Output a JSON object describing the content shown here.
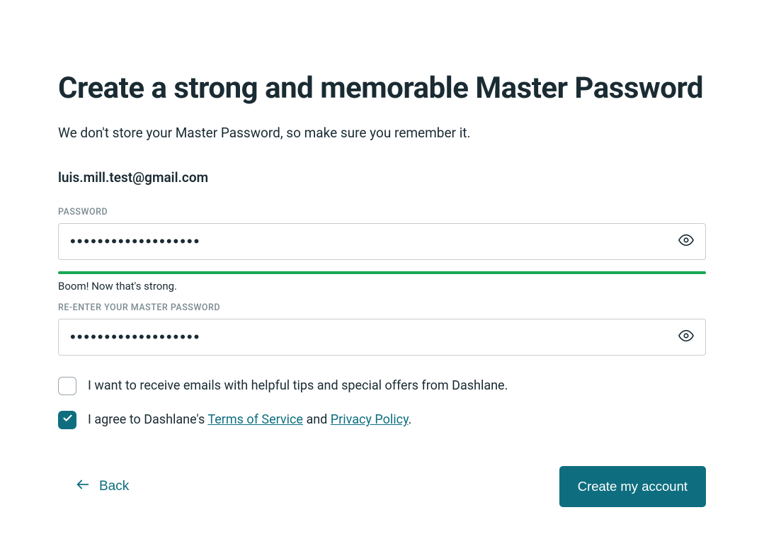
{
  "title": "Create a strong and memorable Master Password",
  "subtitle": "We don't store your Master Password, so make sure you remember it.",
  "email": "luis.mill.test@gmail.com",
  "password_field": {
    "label": "PASSWORD",
    "value": "•••••••••••••••••••"
  },
  "strength_text": "Boom! Now that's strong.",
  "strength_color": "#18a854",
  "confirm_field": {
    "label": "RE-ENTER YOUR MASTER PASSWORD",
    "value": "•••••••••••••••••••"
  },
  "checkboxes": {
    "emails": {
      "checked": false,
      "label": "I want to receive emails with helpful tips and special offers from Dashlane."
    },
    "terms": {
      "checked": true,
      "prefix": "I agree to Dashlane's ",
      "tos_text": "Terms of Service",
      "middle": " and ",
      "privacy_text": "Privacy Policy",
      "suffix": "."
    }
  },
  "buttons": {
    "back": "Back",
    "create": "Create my account"
  }
}
